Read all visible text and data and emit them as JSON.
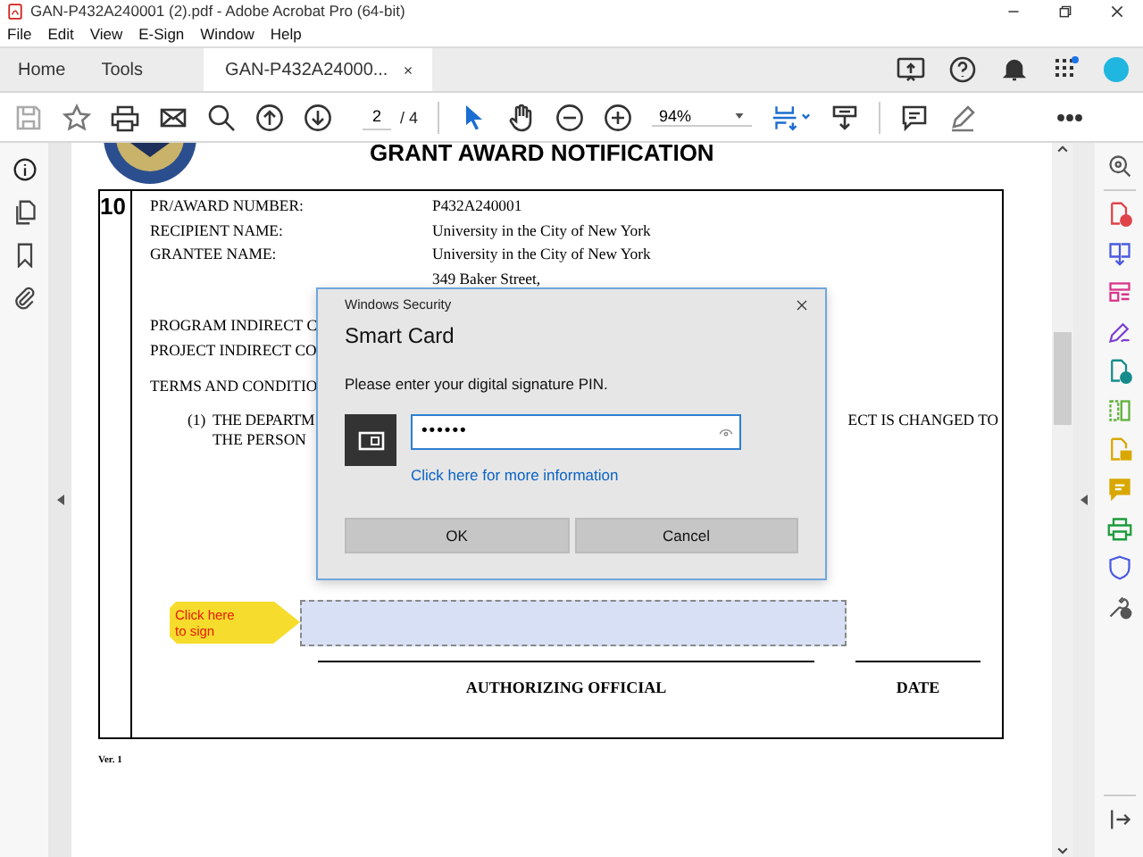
{
  "window": {
    "title": "GAN-P432A240001 (2).pdf - Adobe Acrobat Pro (64-bit)"
  },
  "menu": [
    "File",
    "Edit",
    "View",
    "E-Sign",
    "Window",
    "Help"
  ],
  "tabs": [
    {
      "label": "Home",
      "selected": false,
      "closable": false
    },
    {
      "label": "Tools",
      "selected": false,
      "closable": false
    },
    {
      "label": "GAN-P432A24000...",
      "selected": true,
      "closable": true
    }
  ],
  "toolbar": {
    "page_current": "2",
    "page_total": "/ 4",
    "zoom": "94%"
  },
  "document": {
    "heading": "GRANT AWARD NOTIFICATION",
    "section_number": "10",
    "fields": [
      {
        "label": "PR/AWARD NUMBER:",
        "value": "P432A240001"
      },
      {
        "label": "RECIPIENT NAME:",
        "value": "University in the City of New York"
      },
      {
        "label": "GRANTEE NAME:",
        "value": "University in the City of New York"
      },
      {
        "value": "349 Baker Street,"
      }
    ],
    "partial_lines": [
      "PROGRAM INDIRECT C",
      "PROJECT INDIRECT CO"
    ],
    "terms_heading": "TERMS AND CONDITIO",
    "clause": {
      "number": "(1)",
      "left": "THE DEPARTM",
      "right": "ECT IS CHANGED TO",
      "continuation": "THE PERSON"
    },
    "sign_tag": "Click here to sign",
    "signature_labels": [
      "AUTHORIZING OFFICIAL",
      "DATE"
    ],
    "version": "Ver. 1"
  },
  "dialog": {
    "caption": "Windows Security",
    "title": "Smart Card",
    "prompt": "Please enter your digital signature PIN.",
    "pin_value": "••••••",
    "link": "Click here for more information",
    "buttons": [
      "OK",
      "Cancel"
    ]
  }
}
